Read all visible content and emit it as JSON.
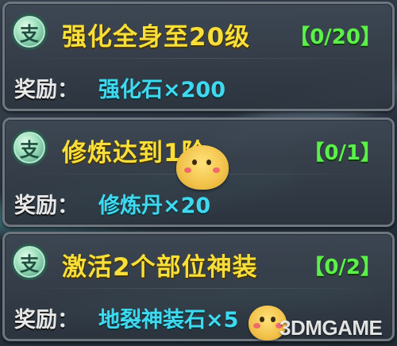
{
  "quests": [
    {
      "badge": "支",
      "title": "强化全身至20级",
      "progress": "【0/20】",
      "reward_label": "奖励：",
      "reward": "强化石×200"
    },
    {
      "badge": "支",
      "title": "修炼达到1阶",
      "progress": "【0/1】",
      "reward_label": "奖励：",
      "reward": "修炼丹×20"
    },
    {
      "badge": "支",
      "title": "激活2个部位神装",
      "progress": "【0/2】",
      "reward_label": "奖励：",
      "reward": "地裂神装石×5"
    }
  ],
  "watermark": "3DMGAME",
  "colors": {
    "title": "#f7df3a",
    "progress": "#5cf04a",
    "reward": "#3fd9ef",
    "label": "#e8e8e8"
  },
  "icons": {
    "badge": "branch-quest-badge-icon",
    "mascot": "mascot-icon"
  }
}
